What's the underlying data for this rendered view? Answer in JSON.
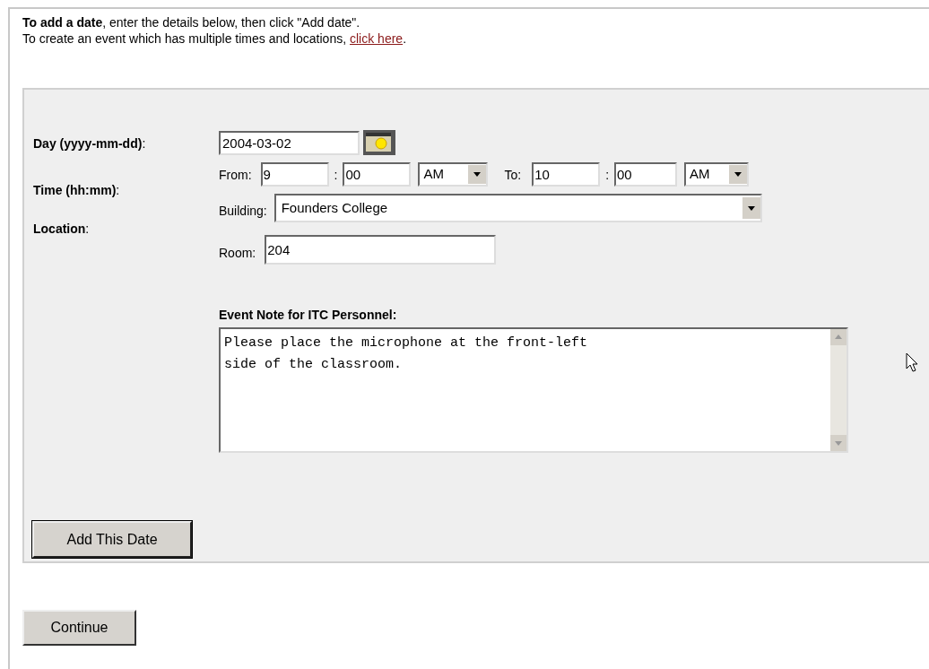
{
  "intro": {
    "line_1": "**To add a date**, enter the details below, then click \"Add date\".",
    "line_2": {
      "text": "To create an event which has multiple times and locations, ",
      "link": "click here",
      "after": "."
    }
  },
  "form": {
    "day": {
      "label": "**Day (yyyy-mm-dd)**:",
      "value": "2004-03-02"
    },
    "time": {
      "label": "**Time (hh:mm)**:",
      "from_label": "From:",
      "from_hour": "9",
      "separator_1": ":",
      "from_minute": "00",
      "from_ampm": "AM",
      "to_label": "To:",
      "to_hour": "10",
      "separator_2": ":",
      "to_minute": "00",
      "to_ampm": "AM"
    },
    "location": {
      "label": "**Location**:",
      "building_label": "Building:",
      "building": "Founders College",
      "room_label": "Room:",
      "room": "204"
    },
    "note": {
      "label": "Event Note for ITC Personnel:",
      "value": "Please place the microphone at the front-left\nside of the classroom."
    },
    "add_button": "Add This Date"
  },
  "continue_button": "Continue"
}
